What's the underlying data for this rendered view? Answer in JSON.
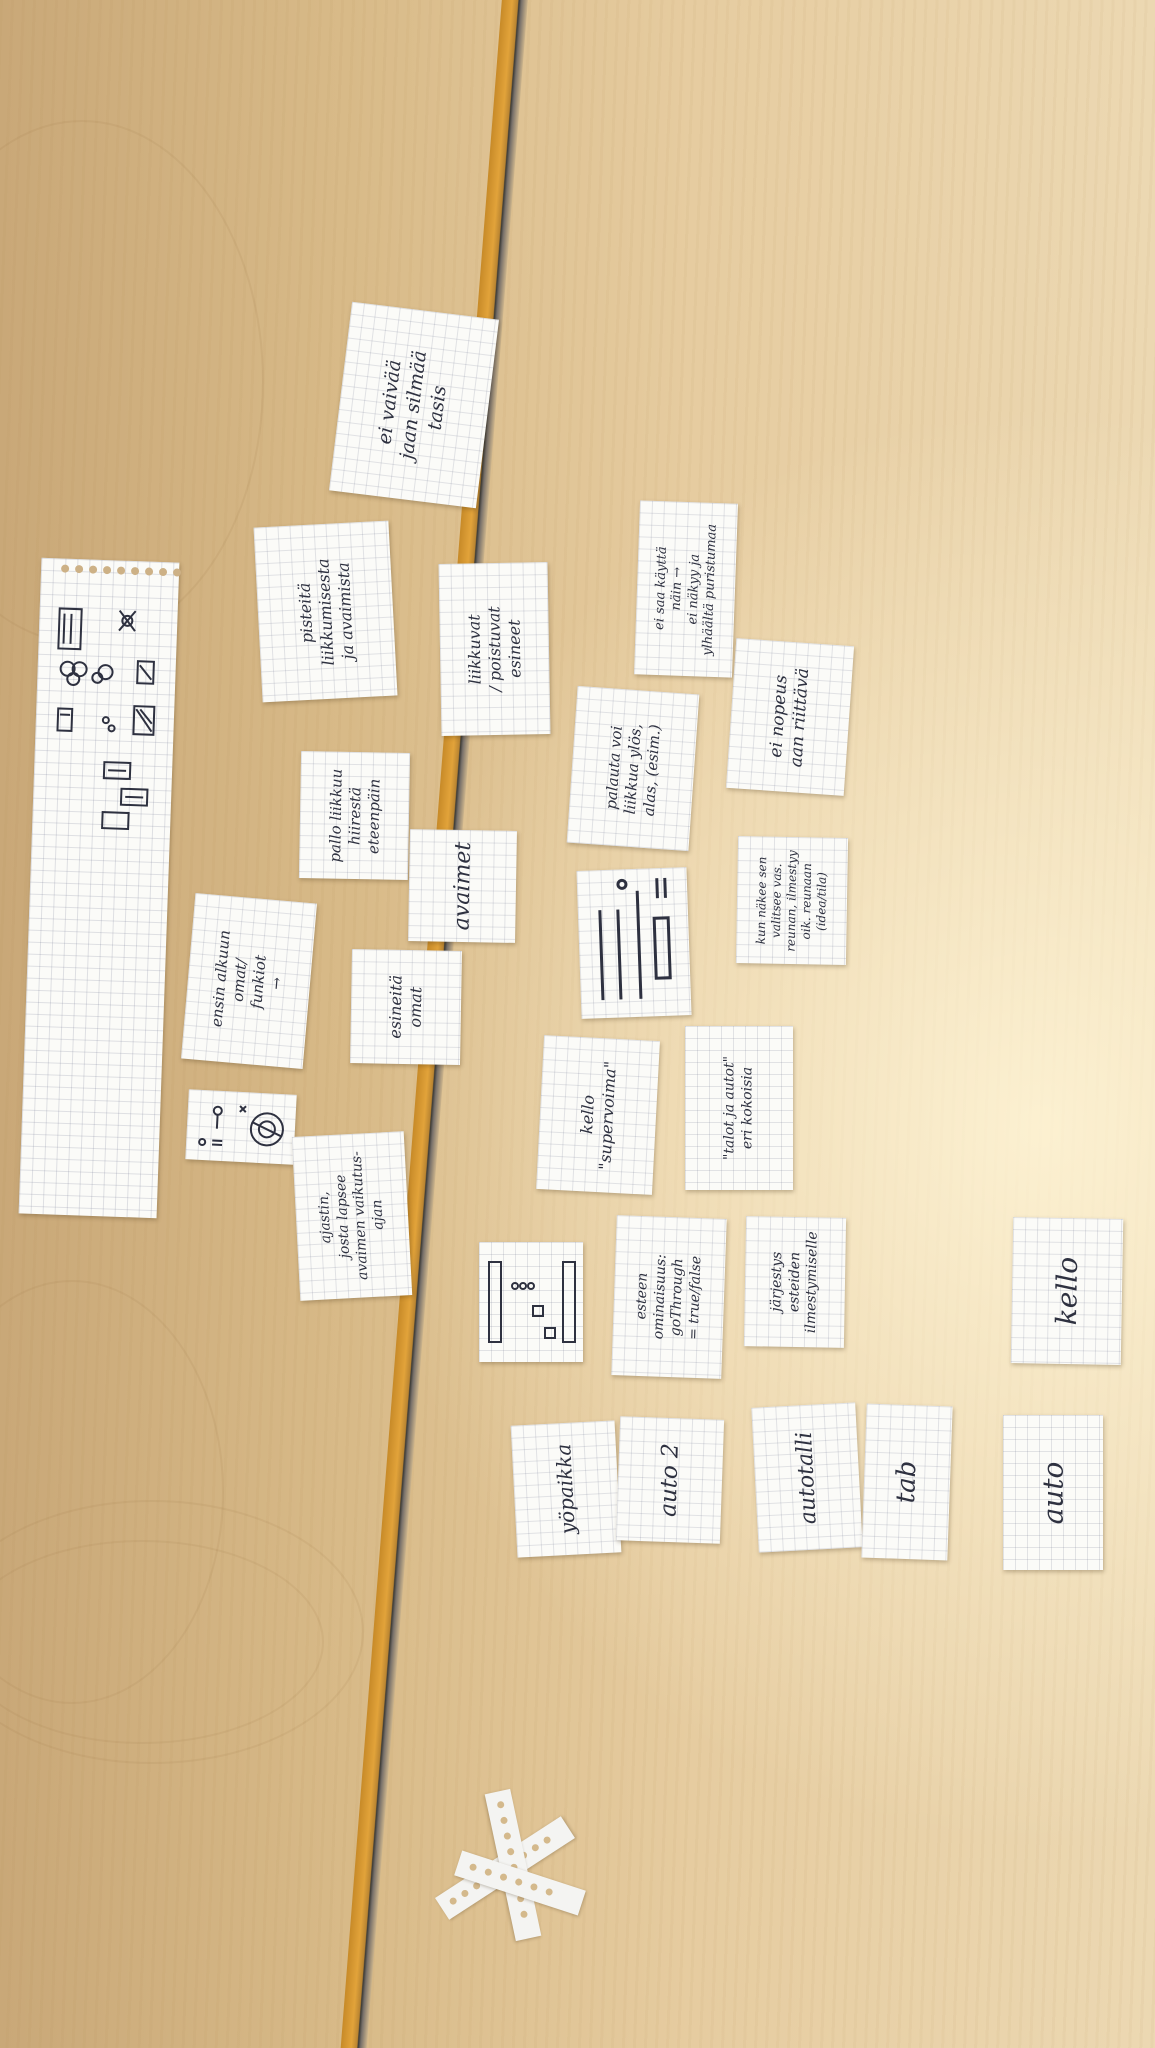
{
  "colors": {
    "wood": "#e6cca0",
    "paper": "#fbfbf8",
    "ink": "#2e3140",
    "seam": "#e2a33a"
  },
  "notes": {
    "ei_vaiva": "ei vaivää\njaan silmää\ntasis",
    "pisteta": "pisteitä\nliikkumisesta\nja avaimista",
    "liikkuvat": "liikkuvat\n/ poistuvat\nesineet",
    "pallo": "pallo liikkuu\nhiirestä\neteenpäin",
    "avaimet": "avaimet",
    "esineita": "esineitä\nomat",
    "ensin_alku": "ensin alkuun\nomat/\nfunkiot\n→",
    "ajastin": "ajastin,\njosta lapsee\navaimen vaikutus-\najan",
    "ei_saa_kaytta": "ei saa käyttä\nnäin →\nei näkyy ja\nylhäältä puristumaa",
    "ei_nopeus": "ei nopeus\naan riittävä",
    "palautus": "palauta voi\nliikkua ylös,\nalas, (esim.)",
    "kun_nakee": "kun näkee sen\nvalitsee vas.\nreunan, ilmestyy\noik. reunaan\n(idea/tila)",
    "kello_supervoima": "kello\n\"supervoima\"",
    "talot": "\"talot ja autot\"\neri kokoisia",
    "esteen": "esteen\nominaisuus:\ngoThrough\n= true/false",
    "jarjestys": "järjestys\nesteiden\nilmestymiselle",
    "kello": "kello",
    "yopaikka": "yöpaikka",
    "auto2": "auto 2",
    "autotalli": "autotalli",
    "tab": "tab",
    "auto": "auto"
  }
}
